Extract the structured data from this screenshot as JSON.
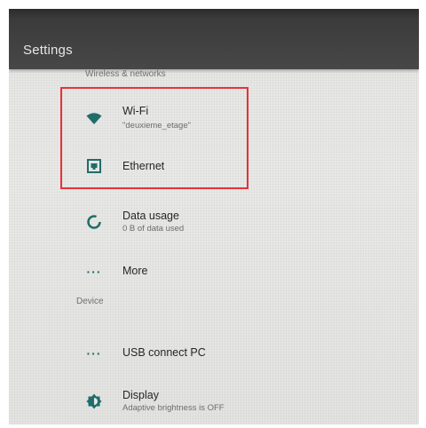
{
  "app_bar": {
    "title": "Settings"
  },
  "sections": {
    "wireless": {
      "header": "Wireless & networks"
    },
    "device": {
      "header": "Device"
    }
  },
  "items": {
    "wifi": {
      "title": "Wi-Fi",
      "summary": "\"deuxieme_etage\"",
      "icon": "wifi-icon"
    },
    "ethernet": {
      "title": "Ethernet",
      "icon": "ethernet-icon"
    },
    "data_usage": {
      "title": "Data usage",
      "summary": "0 B of data used",
      "icon": "data-usage-icon"
    },
    "more": {
      "title": "More",
      "icon": "more-icon"
    },
    "usb": {
      "title": "USB connect PC",
      "icon": "more-icon"
    },
    "display": {
      "title": "Display",
      "summary": "Adaptive brightness is OFF",
      "icon": "brightness-icon"
    }
  },
  "colors": {
    "accent": "#1f6e6a",
    "highlight": "#e8323a",
    "app_bar": "#404040"
  }
}
